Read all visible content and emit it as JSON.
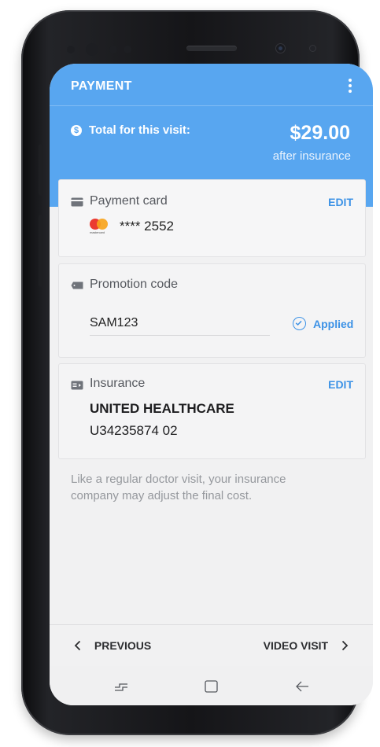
{
  "header": {
    "title": "PAYMENT",
    "total_label": "Total for this visit:",
    "total_amount": "$29.00",
    "total_sub": "after insurance"
  },
  "payment_card": {
    "label": "Payment card",
    "edit_label": "EDIT",
    "brand_text": "mastercard",
    "number": "**** 2552"
  },
  "promotion": {
    "label": "Promotion code",
    "code": "SAM123",
    "status": "Applied"
  },
  "insurance": {
    "label": "Insurance",
    "edit_label": "EDIT",
    "provider": "UNITED HEALTHCARE",
    "member_id": "U34235874 02"
  },
  "disclaimer": "Like a regular doctor visit, your insurance company may adjust the final cost.",
  "footer": {
    "previous_label": "PREVIOUS",
    "next_label": "VIDEO VISIT"
  },
  "colors": {
    "accent": "#58a6f0",
    "link": "#3c92e6",
    "mastercard_red": "#eb3b31",
    "mastercard_orange": "#f7a41c"
  },
  "icons": [
    "kebab-menu-icon",
    "dollar-icon",
    "credit-card-icon",
    "tag-icon",
    "insurance-card-icon",
    "check-circle-icon",
    "chevron-left-icon",
    "chevron-right-icon",
    "recent-apps-icon",
    "home-icon",
    "back-icon"
  ]
}
